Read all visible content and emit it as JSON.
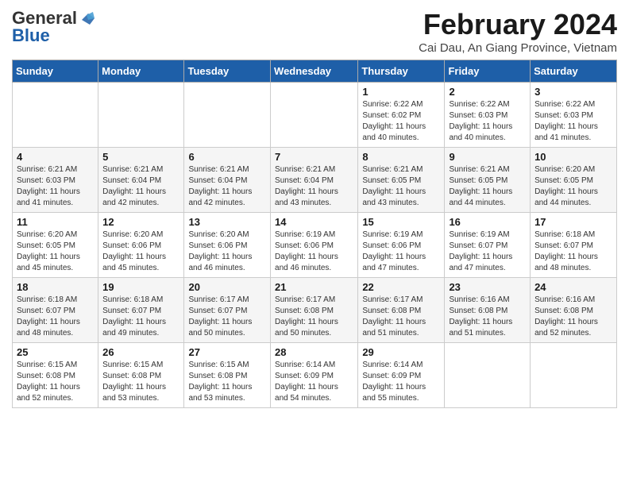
{
  "logo": {
    "line1a": "General",
    "line1b": "Blue"
  },
  "header": {
    "title": "February 2024",
    "subtitle": "Cai Dau, An Giang Province, Vietnam"
  },
  "weekdays": [
    "Sunday",
    "Monday",
    "Tuesday",
    "Wednesday",
    "Thursday",
    "Friday",
    "Saturday"
  ],
  "weeks": [
    [
      {
        "day": "",
        "info": ""
      },
      {
        "day": "",
        "info": ""
      },
      {
        "day": "",
        "info": ""
      },
      {
        "day": "",
        "info": ""
      },
      {
        "day": "1",
        "info": "Sunrise: 6:22 AM\nSunset: 6:02 PM\nDaylight: 11 hours and 40 minutes."
      },
      {
        "day": "2",
        "info": "Sunrise: 6:22 AM\nSunset: 6:03 PM\nDaylight: 11 hours and 40 minutes."
      },
      {
        "day": "3",
        "info": "Sunrise: 6:22 AM\nSunset: 6:03 PM\nDaylight: 11 hours and 41 minutes."
      }
    ],
    [
      {
        "day": "4",
        "info": "Sunrise: 6:21 AM\nSunset: 6:03 PM\nDaylight: 11 hours and 41 minutes."
      },
      {
        "day": "5",
        "info": "Sunrise: 6:21 AM\nSunset: 6:04 PM\nDaylight: 11 hours and 42 minutes."
      },
      {
        "day": "6",
        "info": "Sunrise: 6:21 AM\nSunset: 6:04 PM\nDaylight: 11 hours and 42 minutes."
      },
      {
        "day": "7",
        "info": "Sunrise: 6:21 AM\nSunset: 6:04 PM\nDaylight: 11 hours and 43 minutes."
      },
      {
        "day": "8",
        "info": "Sunrise: 6:21 AM\nSunset: 6:05 PM\nDaylight: 11 hours and 43 minutes."
      },
      {
        "day": "9",
        "info": "Sunrise: 6:21 AM\nSunset: 6:05 PM\nDaylight: 11 hours and 44 minutes."
      },
      {
        "day": "10",
        "info": "Sunrise: 6:20 AM\nSunset: 6:05 PM\nDaylight: 11 hours and 44 minutes."
      }
    ],
    [
      {
        "day": "11",
        "info": "Sunrise: 6:20 AM\nSunset: 6:05 PM\nDaylight: 11 hours and 45 minutes."
      },
      {
        "day": "12",
        "info": "Sunrise: 6:20 AM\nSunset: 6:06 PM\nDaylight: 11 hours and 45 minutes."
      },
      {
        "day": "13",
        "info": "Sunrise: 6:20 AM\nSunset: 6:06 PM\nDaylight: 11 hours and 46 minutes."
      },
      {
        "day": "14",
        "info": "Sunrise: 6:19 AM\nSunset: 6:06 PM\nDaylight: 11 hours and 46 minutes."
      },
      {
        "day": "15",
        "info": "Sunrise: 6:19 AM\nSunset: 6:06 PM\nDaylight: 11 hours and 47 minutes."
      },
      {
        "day": "16",
        "info": "Sunrise: 6:19 AM\nSunset: 6:07 PM\nDaylight: 11 hours and 47 minutes."
      },
      {
        "day": "17",
        "info": "Sunrise: 6:18 AM\nSunset: 6:07 PM\nDaylight: 11 hours and 48 minutes."
      }
    ],
    [
      {
        "day": "18",
        "info": "Sunrise: 6:18 AM\nSunset: 6:07 PM\nDaylight: 11 hours and 48 minutes."
      },
      {
        "day": "19",
        "info": "Sunrise: 6:18 AM\nSunset: 6:07 PM\nDaylight: 11 hours and 49 minutes."
      },
      {
        "day": "20",
        "info": "Sunrise: 6:17 AM\nSunset: 6:07 PM\nDaylight: 11 hours and 50 minutes."
      },
      {
        "day": "21",
        "info": "Sunrise: 6:17 AM\nSunset: 6:08 PM\nDaylight: 11 hours and 50 minutes."
      },
      {
        "day": "22",
        "info": "Sunrise: 6:17 AM\nSunset: 6:08 PM\nDaylight: 11 hours and 51 minutes."
      },
      {
        "day": "23",
        "info": "Sunrise: 6:16 AM\nSunset: 6:08 PM\nDaylight: 11 hours and 51 minutes."
      },
      {
        "day": "24",
        "info": "Sunrise: 6:16 AM\nSunset: 6:08 PM\nDaylight: 11 hours and 52 minutes."
      }
    ],
    [
      {
        "day": "25",
        "info": "Sunrise: 6:15 AM\nSunset: 6:08 PM\nDaylight: 11 hours and 52 minutes."
      },
      {
        "day": "26",
        "info": "Sunrise: 6:15 AM\nSunset: 6:08 PM\nDaylight: 11 hours and 53 minutes."
      },
      {
        "day": "27",
        "info": "Sunrise: 6:15 AM\nSunset: 6:08 PM\nDaylight: 11 hours and 53 minutes."
      },
      {
        "day": "28",
        "info": "Sunrise: 6:14 AM\nSunset: 6:09 PM\nDaylight: 11 hours and 54 minutes."
      },
      {
        "day": "29",
        "info": "Sunrise: 6:14 AM\nSunset: 6:09 PM\nDaylight: 11 hours and 55 minutes."
      },
      {
        "day": "",
        "info": ""
      },
      {
        "day": "",
        "info": ""
      }
    ]
  ]
}
